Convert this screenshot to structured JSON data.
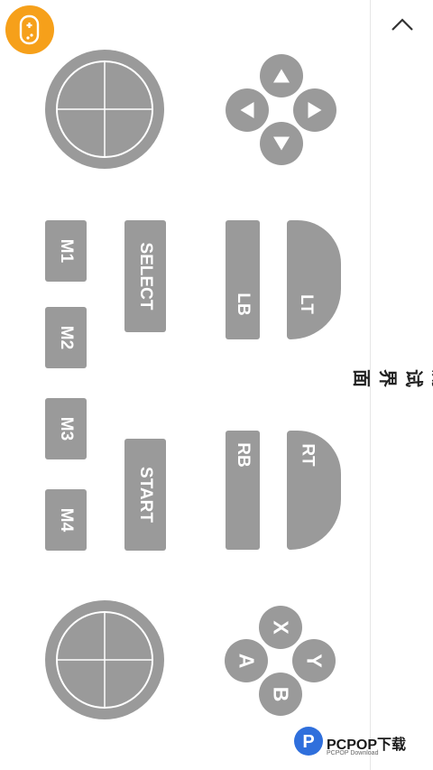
{
  "panel": {
    "title": "测试界面",
    "collapse_icon": "chevron-up-icon"
  },
  "buttons": {
    "m1": "M1",
    "m2": "M2",
    "m3": "M3",
    "m4": "M4",
    "select": "SELECT",
    "start": "START",
    "lb": "LB",
    "lt": "LT",
    "rb": "RB",
    "rt": "RT",
    "x": "X",
    "y": "Y",
    "a": "A",
    "b": "B"
  },
  "watermark": {
    "text": "PCPOP下载",
    "sub": "PCPOP Download"
  },
  "colors": {
    "control": "#9a9a9a",
    "logo": "#f6a01a",
    "watermark_blue": "#2f6fdc"
  }
}
